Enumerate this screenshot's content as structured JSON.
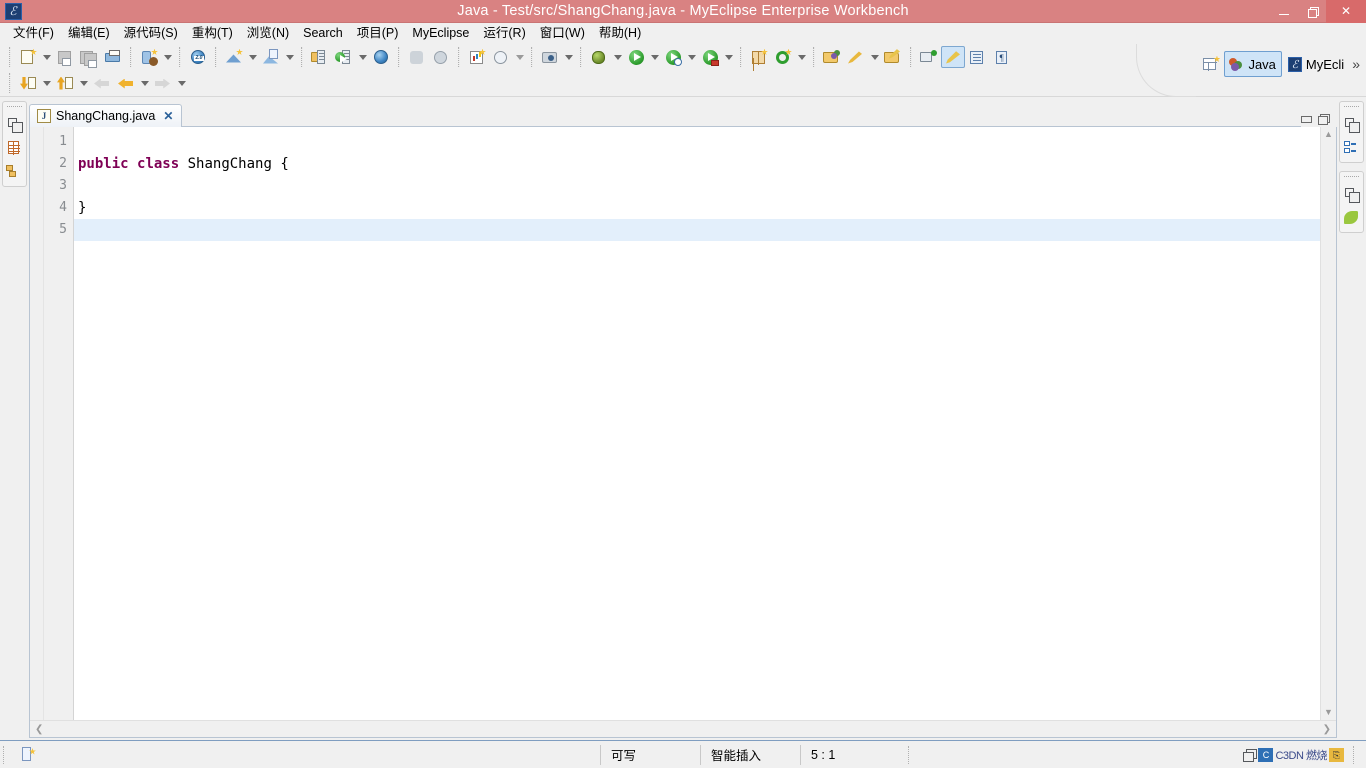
{
  "window": {
    "title": "Java  -  Test/src/ShangChang.java  -  MyEclipse Enterprise Workbench",
    "app_icon": "myeclipse-icon",
    "titlebar_color": "#d98282",
    "controls": {
      "minimize": "minimize-button",
      "restore": "restore-button",
      "close": "✕"
    }
  },
  "menubar": {
    "items": [
      {
        "label": "文件(F)",
        "name": "menu-file"
      },
      {
        "label": "编辑(E)",
        "name": "menu-edit"
      },
      {
        "label": "源代码(S)",
        "name": "menu-source"
      },
      {
        "label": "重构(T)",
        "name": "menu-refactor"
      },
      {
        "label": "浏览(N)",
        "name": "menu-navigate"
      },
      {
        "label": "Search",
        "name": "menu-search"
      },
      {
        "label": "项目(P)",
        "name": "menu-project"
      },
      {
        "label": "MyEclipse",
        "name": "menu-myeclipse"
      },
      {
        "label": "运行(R)",
        "name": "menu-run"
      },
      {
        "label": "窗口(W)",
        "name": "menu-window"
      },
      {
        "label": "帮助(H)",
        "name": "menu-help"
      }
    ]
  },
  "toolbar": {
    "row1": [
      "new-wizard-icon",
      "new-wizard-dropdown",
      "save-icon",
      "save-all-icon",
      "print-icon",
      "new-java-project-icon",
      "new-java-project-dropdown",
      "open-web-browser-icon",
      "new-web-project-icon",
      "new-web-project-dropdown",
      "new-web-service-icon",
      "new-web-service-dropdown",
      "deploy-icon",
      "run-server-icon",
      "run-server-dropdown",
      "open-browser-globe-icon",
      "db-connect-icon",
      "db-refresh-icon",
      "open-report-icon",
      "disabled-globe-icon",
      "disabled-globe-dropdown",
      "camera-icon",
      "camera-dropdown",
      "debug-icon",
      "debug-dropdown",
      "run-icon",
      "run-dropdown",
      "run-history-icon",
      "run-history-dropdown",
      "run-external-icon",
      "run-external-dropdown",
      "new-class-icon",
      "new-annotation-icon",
      "new-annotation-dropdown",
      "open-type-icon",
      "open-task-icon",
      "open-task-dropdown",
      "open-resource-icon",
      "next-annotation-icon",
      "toggle-mark-occurrences-icon",
      "toggle-block-selection-icon",
      "show-whitespace-icon"
    ],
    "row2": [
      "import-icon",
      "import-dropdown",
      "export-icon",
      "export-dropdown",
      "back-disabled-icon",
      "back-icon",
      "back-dropdown",
      "forward-icon",
      "forward-dropdown"
    ]
  },
  "perspective_bar": {
    "open_perspective_icon": "open-perspective-icon",
    "items": [
      {
        "label": "Java",
        "name": "perspective-java",
        "active": true,
        "icon": "java-perspective-icon"
      },
      {
        "label": "MyEcli",
        "name": "perspective-myeclipse",
        "active": false,
        "icon": "myeclipse-perspective-icon"
      }
    ],
    "overflow": "»"
  },
  "left_fastview": {
    "groups": [
      {
        "icons": [
          "restore-view-icon",
          "package-explorer-icon",
          "hierarchy-icon"
        ]
      }
    ]
  },
  "right_fastview": {
    "groups": [
      {
        "icons": [
          "restore-view-icon",
          "outline-icon"
        ]
      },
      {
        "icons": [
          "restore-view-icon",
          "myeclipse-leaf-icon"
        ]
      }
    ]
  },
  "editor": {
    "tab": {
      "label": "ShangChang.java",
      "file_icon": "java-file-icon",
      "close_icon": "✕",
      "dirty": false
    },
    "controls": {
      "minimize": "minimize-editor-icon",
      "maximize": "maximize-editor-icon"
    },
    "line_numbers": [
      "1",
      "2",
      "3",
      "4",
      "5"
    ],
    "lines": [
      {
        "n": 1,
        "tokens": []
      },
      {
        "n": 2,
        "tokens": [
          {
            "t": "public",
            "cls": "kw"
          },
          {
            "t": " ",
            "cls": ""
          },
          {
            "t": "class",
            "cls": "kw"
          },
          {
            "t": " ShangChang {",
            "cls": ""
          }
        ]
      },
      {
        "n": 3,
        "tokens": []
      },
      {
        "n": 4,
        "tokens": [
          {
            "t": "}",
            "cls": ""
          }
        ]
      },
      {
        "n": 5,
        "tokens": [],
        "current": true
      }
    ],
    "scroll": {
      "up": "▲",
      "down": "▼",
      "left": "❮",
      "right": "❯"
    },
    "keyword_color": "#7f0055",
    "current_line_color": "#e3effb"
  },
  "statusbar": {
    "left_icon": "resource-marker-icon",
    "cells": [
      {
        "label": "",
        "name": "status-message"
      },
      {
        "label": "可写",
        "name": "status-writable"
      },
      {
        "label": "智能插入",
        "name": "status-insert-mode"
      },
      {
        "label": "5 : 1",
        "name": "status-cursor-position"
      }
    ],
    "watermark": {
      "text": "C3DN 燃烧",
      "icons": [
        "restore-icon",
        "cert-icon",
        "copy-icon"
      ]
    }
  }
}
